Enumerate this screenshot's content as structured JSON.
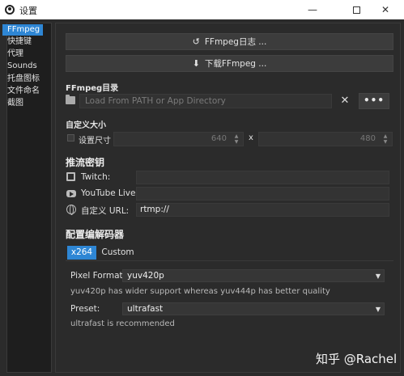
{
  "window": {
    "title": "设置",
    "min_icon": "minimize-icon",
    "max_icon": "maximize-icon",
    "close_glyph": "✕"
  },
  "sidebar": {
    "items": [
      {
        "label": "FFmpeg",
        "active": true
      },
      {
        "label": "快捷键"
      },
      {
        "label": "代理"
      },
      {
        "label": "Sounds"
      },
      {
        "label": "托盘图标"
      },
      {
        "label": "文件命名"
      },
      {
        "label": "截图"
      }
    ]
  },
  "ffmpeg": {
    "log_button": "FFmpeg日志 ...",
    "download_button": "下载FFmpeg ...",
    "dir_label": "FFmpeg目录",
    "path_placeholder": "Load From PATH or App Directory",
    "clear_glyph": "✕",
    "more_label": "•••"
  },
  "custom_size": {
    "label": "自定义大小",
    "checkbox_label": "设置尺寸",
    "width": "640",
    "height": "480",
    "separator": "x"
  },
  "stream_keys": {
    "heading": "推流密钥",
    "twitch_label": "Twitch:",
    "twitch_value": "",
    "youtube_label": "YouTube Live:",
    "youtube_value": "",
    "custom_label": "自定义 URL:",
    "custom_value": "rtmp://"
  },
  "encoders": {
    "heading": "配置编解码器",
    "tabs": [
      "x264",
      "Custom"
    ],
    "pixel_format_label": "Pixel Format:",
    "pixel_format_value": "yuv420p",
    "pixel_format_hint": "yuv420p has wider support whereas yuv444p has better quality",
    "preset_label": "Preset:",
    "preset_value": "ultrafast",
    "preset_hint": "ultrafast is recommended"
  },
  "watermark": "知乎 @Rachel"
}
